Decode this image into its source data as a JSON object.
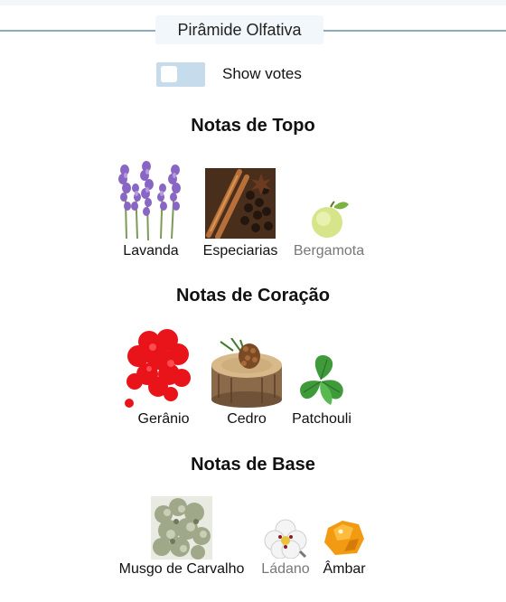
{
  "title": "Pirâmide Olfativa",
  "toggle": {
    "label": "Show votes",
    "checked": false
  },
  "sections": {
    "top": {
      "heading": "Notas de Topo",
      "notes": [
        {
          "name": "Lavanda",
          "icon": "lavender-icon"
        },
        {
          "name": "Especiarias",
          "icon": "spices-icon"
        },
        {
          "name": "Bergamota",
          "icon": "bergamot-icon"
        }
      ]
    },
    "heart": {
      "heading": "Notas de Coração",
      "notes": [
        {
          "name": "Gerânio",
          "icon": "geranium-icon"
        },
        {
          "name": "Cedro",
          "icon": "cedar-icon"
        },
        {
          "name": "Patchouli",
          "icon": "patchouli-icon"
        }
      ]
    },
    "base": {
      "heading": "Notas de Base",
      "notes": [
        {
          "name": "Musgo de Carvalho",
          "icon": "oakmoss-icon"
        },
        {
          "name": "Ládano",
          "icon": "labdanum-icon"
        },
        {
          "name": "Âmbar",
          "icon": "amber-icon"
        }
      ]
    }
  }
}
